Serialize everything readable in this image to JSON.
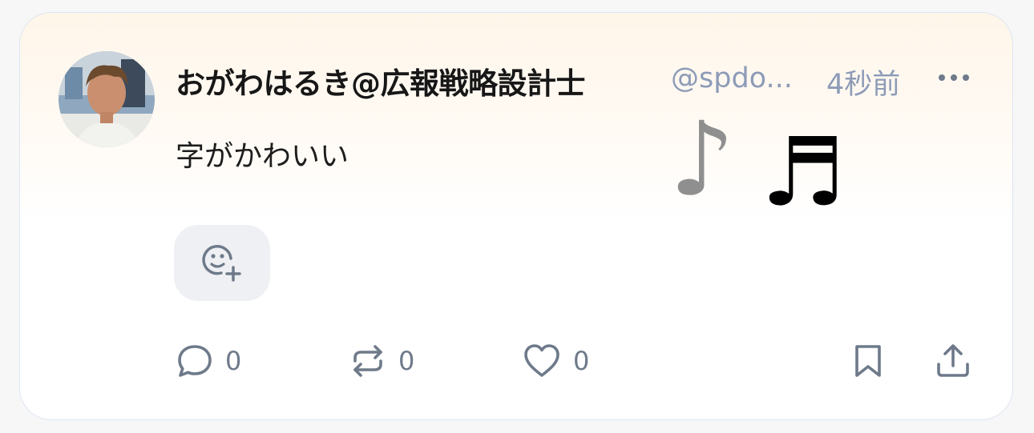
{
  "post": {
    "display_name": "おがわはるき@広報戦略設計士",
    "handle": "@spdo...",
    "timestamp": "4秒前",
    "text": "字がかわいい",
    "decorations": [
      "♪",
      "♬"
    ],
    "avatar": "user-photo",
    "more_icon": "ellipsis-icon",
    "reaction_icon": "emoji-add-icon"
  },
  "actions": {
    "reply": {
      "icon": "comment-icon",
      "count": "0"
    },
    "repost": {
      "icon": "repost-icon",
      "count": "0"
    },
    "like": {
      "icon": "heart-icon",
      "count": "0"
    },
    "bookmark": {
      "icon": "bookmark-icon"
    },
    "share": {
      "icon": "share-icon"
    }
  },
  "colors": {
    "handle": "#8d9bb7",
    "icon": "#6e7a8a",
    "card_tint": "#fff6ea",
    "reaction_bg": "#eef0f3"
  }
}
